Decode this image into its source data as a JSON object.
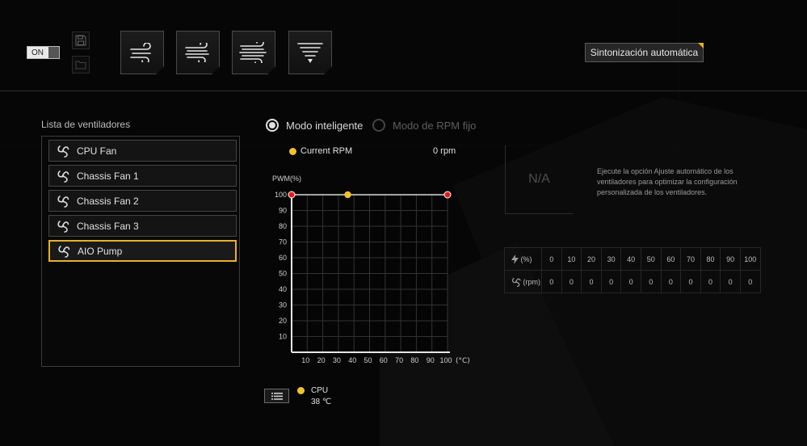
{
  "toolbar": {
    "toggle_label": "ON",
    "toggle_state": "on",
    "presets": [
      {
        "name": "silent",
        "icon": "wind-1-icon"
      },
      {
        "name": "standard",
        "icon": "wind-2-icon"
      },
      {
        "name": "turbo",
        "icon": "wind-3-icon"
      },
      {
        "name": "full-speed",
        "icon": "tornado-icon"
      }
    ],
    "autotune_label": "Sintonización automática",
    "accent": "#e8b02c"
  },
  "fan_list": {
    "title": "Lista de ventiladores",
    "items": [
      {
        "label": "CPU Fan",
        "selected": false
      },
      {
        "label": "Chassis Fan 1",
        "selected": false
      },
      {
        "label": "Chassis Fan 2",
        "selected": false
      },
      {
        "label": "Chassis Fan 3",
        "selected": false
      },
      {
        "label": "AIO Pump",
        "selected": true
      }
    ]
  },
  "mode": {
    "smart_label": "Modo inteligente",
    "fixed_label": "Modo de RPM fijo",
    "selected": "smart"
  },
  "current_rpm": {
    "label": "Current RPM",
    "value": "0 rpm"
  },
  "chart_data": {
    "type": "line",
    "ylabel": "PWM(%)",
    "xunit": "(°C)",
    "xlim": [
      0,
      100
    ],
    "ylim": [
      0,
      100
    ],
    "x_ticks": [
      "10",
      "20",
      "30",
      "40",
      "50",
      "60",
      "70",
      "80",
      "90",
      "100"
    ],
    "y_ticks": [
      "100",
      "90",
      "80",
      "70",
      "60",
      "50",
      "40",
      "30",
      "20",
      "10"
    ],
    "grid": true,
    "series": [
      {
        "points": [
          [
            0,
            100
          ],
          [
            100,
            100
          ]
        ],
        "color": "#d9d9d9"
      }
    ],
    "control_points": [
      [
        0,
        100
      ],
      [
        100,
        100
      ]
    ],
    "control_color": "#e01c1c",
    "marker": {
      "x": 36,
      "y": 100,
      "color": "#f2c12e"
    }
  },
  "temperature_source": {
    "name": "CPU",
    "value": "38 ℃"
  },
  "autotune_panel": {
    "na_text": "N/A",
    "description": "Ejecute la opción Ajuste automático de los ventiladores para optimizar la configuración personalizada de los ventiladores."
  },
  "rpm_table": {
    "percent_label": "(%)",
    "rpm_label": "(rpm)",
    "percent_values": [
      "0",
      "10",
      "20",
      "30",
      "40",
      "50",
      "60",
      "70",
      "80",
      "90",
      "100"
    ],
    "rpm_values": [
      "0",
      "0",
      "0",
      "0",
      "0",
      "0",
      "0",
      "0",
      "0",
      "0",
      "0"
    ]
  }
}
